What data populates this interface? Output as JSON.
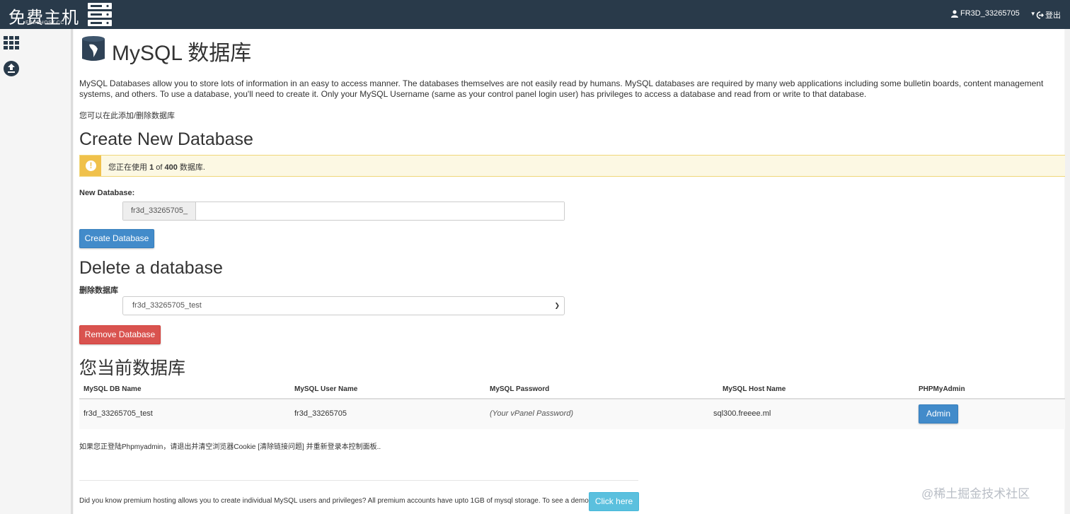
{
  "brand": {
    "logo_text": "免费主机",
    "logo_subtext": "FREEHOST.CC"
  },
  "header": {
    "username": "FR3D_33265705",
    "logout_label": "登出"
  },
  "page": {
    "title": "MySQL 数据库",
    "description": "MySQL Databases allow you to store lots of information in an easy to access manner. The databases themselves are not easily read by humans. MySQL databases are required by many web applications including some bulletin boards, content management systems, and others. To use a database, you'll need to create it. Only your MySQL Username (same as your control panel login user) has privileges to access a database and read from or write to that database.",
    "note": "您可以在此添加/删除数据库"
  },
  "create": {
    "heading": "Create New Database",
    "usage_prefix": "您正在使用",
    "usage_count": "1",
    "usage_of": "of",
    "usage_limit": "400",
    "usage_suffix": "数据库.",
    "new_db_label": "New Database:",
    "db_prefix": "fr3d_33265705_",
    "db_name_value": "",
    "create_button": "Create Database"
  },
  "delete": {
    "heading": "Delete a database",
    "label": "删除数据库",
    "selected": "fr3d_33265705_test",
    "remove_button": "Remove Database"
  },
  "current": {
    "heading": "您当前数据库",
    "columns": [
      "MySQL DB Name",
      "MySQL User Name",
      "MySQL Password",
      "MySQL Host Name",
      "PHPMyAdmin"
    ],
    "rows": [
      {
        "db_name": "fr3d_33265705_test",
        "user_name": "fr3d_33265705",
        "password": "(Your vPanel Password)",
        "host": "sql300.freeee.ml",
        "admin_button": "Admin"
      }
    ]
  },
  "footer": {
    "note": "如果您正登陆Phpmyadmin，请退出并清空浏览器Cookie [清除链接问题] 并重新登录本控制面板..",
    "promo": "Did you know premium hosting allows you to create individual MySQL users and privileges? All premium accounts have upto 1GB of mysql storage. To see a demo:",
    "click_here": "Click here"
  },
  "watermark": "@稀土掘金技术社区",
  "icons": {
    "apps": "grid-icon",
    "upload": "upload-icon",
    "user": "user-icon",
    "logout": "logout-icon",
    "mysql": "mysql-dolphin-icon",
    "warning": "exclamation-icon"
  },
  "colors": {
    "topbar": "#293a4a",
    "primary": "#428bca",
    "danger": "#d9534f",
    "info": "#5bc0de",
    "alert_bg": "#fcf8e3",
    "alert_icon": "#f0c14b"
  }
}
